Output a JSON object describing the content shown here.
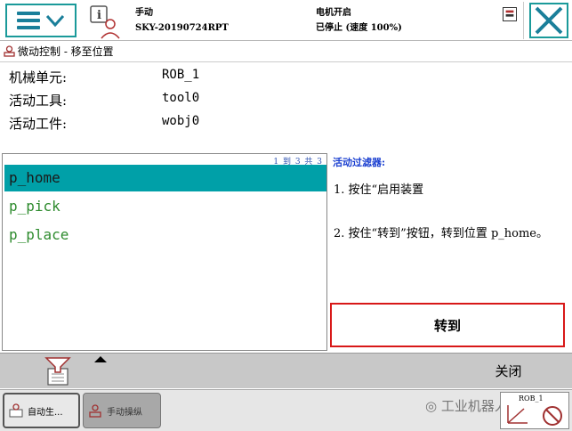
{
  "topbar": {
    "mode": "手动",
    "controller": "SKY-20190724RPT",
    "motor_state": "电机开启",
    "run_state": "已停止 (速度 100%)"
  },
  "title": "微动控制 - 移至位置",
  "info": [
    {
      "label": "机械单元:",
      "value": "ROB_1"
    },
    {
      "label": "活动工具:",
      "value": "tool0"
    },
    {
      "label": "活动工件:",
      "value": "wobj0"
    }
  ],
  "list": {
    "counter": "1 到 3 共 3",
    "items": [
      "p_home",
      "p_pick",
      "p_place"
    ],
    "selected_index": 0
  },
  "right": {
    "filter_label": "活动过滤器:",
    "step1": "1. 按住“启用装置",
    "step2": "2. 按住“转到”按钮，转到位置 p_home。",
    "goto_label": "转到"
  },
  "cmdbar": {
    "close_label": "关闭"
  },
  "taskbar": {
    "task1": "自动生...",
    "task2": "手动操纵",
    "watermark": "工业机器人教学",
    "rob_label": "ROB_1"
  },
  "colors": {
    "accent": "#1a9a9a",
    "selected_row": "#00a0a8",
    "list_text": "#2e8b2e",
    "filter_text": "#1a3fd0",
    "goto_border": "#d81818"
  }
}
